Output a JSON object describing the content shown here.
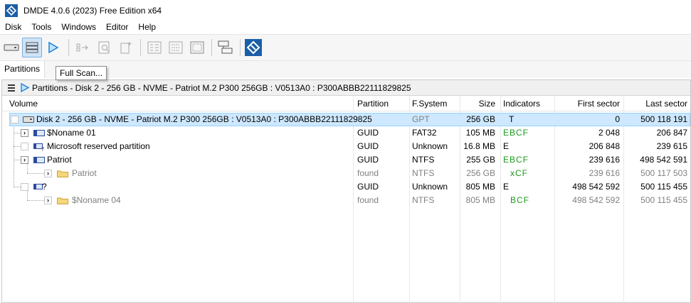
{
  "window": {
    "title": "DMDE 4.0.6 (2023) Free Edition x64"
  },
  "menu": [
    "Disk",
    "Tools",
    "Windows",
    "Editor",
    "Help"
  ],
  "tabs": {
    "partitions": "Partitions"
  },
  "tooltip": "Full Scan...",
  "panel": {
    "title": "Partitions - Disk 2 - 256 GB - NVME - Patriot M.2 P300 256GB : V0513A0 : P300ABBB22111829825"
  },
  "columns": [
    "Volume",
    "Partition",
    "F.System",
    "Size",
    "Indicators",
    "First sector",
    "Last sector"
  ],
  "rows": [
    {
      "volume": "Disk 2 - 256 GB - NVME - Patriot M.2 P300 256GB : V0513A0 : P300ABBB22111829825",
      "partition": "",
      "fs": "GPT",
      "size": "256 GB",
      "ind": "T",
      "first": "0",
      "last": "500 118 191"
    },
    {
      "volume": "$Noname 01",
      "partition": "GUID",
      "fs": "FAT32",
      "size": "105 MB",
      "ind": "EBCF",
      "first": "2 048",
      "last": "206 847"
    },
    {
      "volume": "Microsoft reserved partition",
      "partition": "GUID",
      "fs": "Unknown",
      "size": "16.8 MB",
      "ind": "E",
      "first": "206 848",
      "last": "239 615"
    },
    {
      "volume": "Patriot",
      "partition": "GUID",
      "fs": "NTFS",
      "size": "255 GB",
      "ind": "EBCF",
      "first": "239 616",
      "last": "498 542 591"
    },
    {
      "volume": "Patriot",
      "partition": "found",
      "fs": "NTFS",
      "size": "256 GB",
      "ind": "xCF",
      "first": "239 616",
      "last": "500 117 503"
    },
    {
      "volume": "?",
      "partition": "GUID",
      "fs": "Unknown",
      "size": "805 MB",
      "ind": "E",
      "first": "498 542 592",
      "last": "500 115 455"
    },
    {
      "volume": "$Noname 04",
      "partition": "found",
      "fs": "NTFS",
      "size": "805 MB",
      "ind": "BCF",
      "first": "498 542 592",
      "last": "500 115 455"
    }
  ],
  "colors": {
    "selection": "#cde8ff",
    "indicator_green": "#1a9a1a",
    "accent": "#1a5fa8"
  },
  "icons": [
    "dmde-logo-icon",
    "disk-icon",
    "partitions-view-icon",
    "play-icon",
    "volume-icon",
    "folder-icon"
  ]
}
